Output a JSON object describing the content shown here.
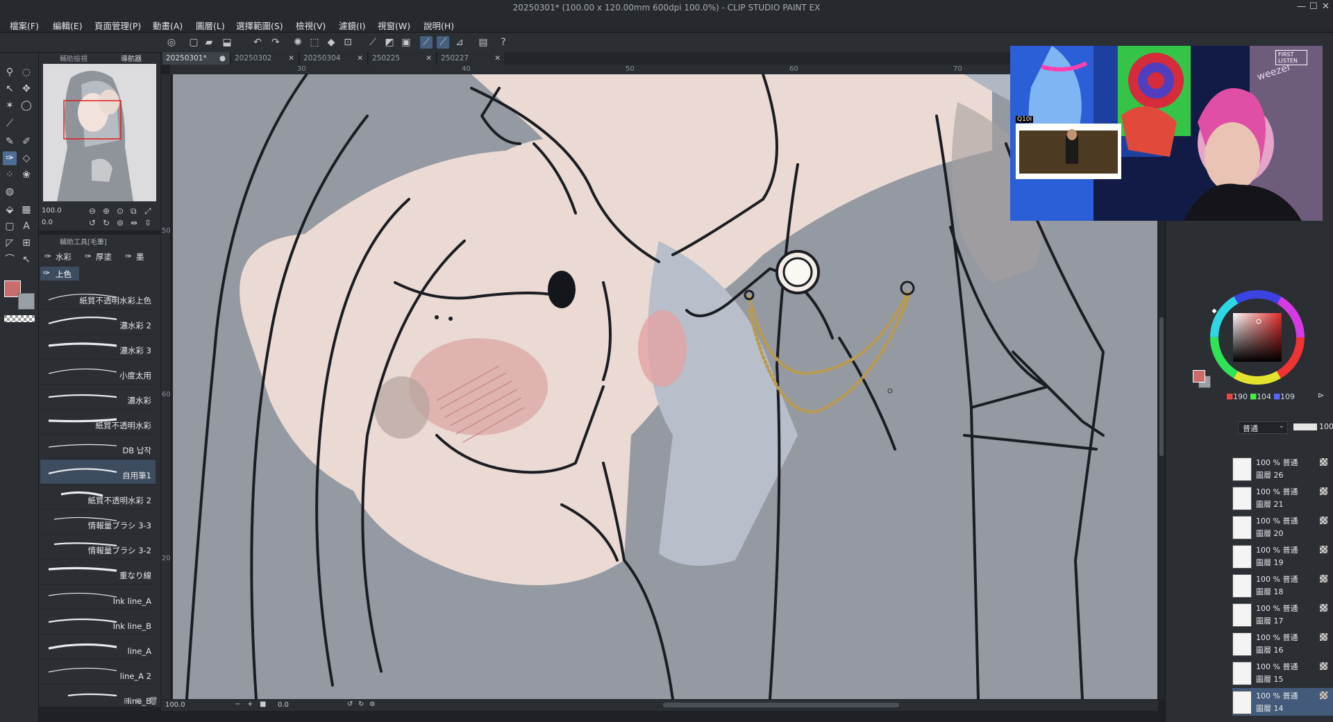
{
  "window": {
    "title": "20250301* (100.00 x 120.00mm 600dpi 100.0%) - CLIP STUDIO PAINT EX",
    "controls": [
      "—",
      "☐",
      "✕"
    ]
  },
  "menubar": {
    "items": [
      "檔案(F)",
      "編輯(E)",
      "頁面管理(P)",
      "動畫(A)",
      "圖層(L)",
      "選擇範圍(S)",
      "檢視(V)",
      "濾鏡(I)",
      "視窗(W)",
      "說明(H)"
    ]
  },
  "navigator": {
    "tabs": [
      "輔助檢視",
      "導航器"
    ],
    "zoom": "100.0",
    "rotate": "0.0"
  },
  "subtool": {
    "header": "輔助工具[毛筆]",
    "tabs": [
      "水彩",
      "厚塗",
      "墨"
    ],
    "group": "上色",
    "brushes": [
      "紙質不透明水彩上色",
      "濃水彩 2",
      "濃水彩 3",
      "小度太用",
      "濃水彩",
      "紙質不透明水彩",
      "DB 납작",
      "自用筆1",
      "紙質不透明水彩 2",
      "情報量ブラシ 3-3",
      "情報量ブラシ 3-2",
      "重なり線",
      "Ink line_A",
      "Ink line_B",
      "line_A",
      "line_A 2",
      "line_B"
    ],
    "selected_index": 7
  },
  "documents": {
    "tabs": [
      "20250301*",
      "20250302",
      "20250304",
      "250225",
      "250227"
    ],
    "active_index": 0
  },
  "ruler": {
    "h_marks": [
      "30",
      "40",
      "50",
      "60",
      "70"
    ],
    "v_marks": [
      "50",
      "60",
      "20"
    ]
  },
  "canvas_status": {
    "zoom": "100.0",
    "angle": "0.0"
  },
  "overlay": {
    "label": "Q10I",
    "logo": "FIRST LISTEN",
    "brand": "weezer"
  },
  "color": {
    "main": "#c96c6d",
    "sub": "#9a9ea6",
    "r": "190",
    "g": "104",
    "b": "109"
  },
  "layers": {
    "blend_mode": "普通",
    "opacity": "100",
    "items": [
      {
        "mode": "100 % 普通",
        "name": "圖層 26"
      },
      {
        "mode": "100 % 普通",
        "name": "圖層 21"
      },
      {
        "mode": "100 % 普通",
        "name": "圖層 20"
      },
      {
        "mode": "100 % 普通",
        "name": "圖層 19"
      },
      {
        "mode": "100 % 普通",
        "name": "圖層 18"
      },
      {
        "mode": "100 % 普通",
        "name": "圖層 17"
      },
      {
        "mode": "100 % 普通",
        "name": "圖層 16"
      },
      {
        "mode": "100 % 普通",
        "name": "圖層 15"
      },
      {
        "mode": "100 % 普通",
        "name": "圖層 14"
      }
    ],
    "selected_index": 8
  }
}
